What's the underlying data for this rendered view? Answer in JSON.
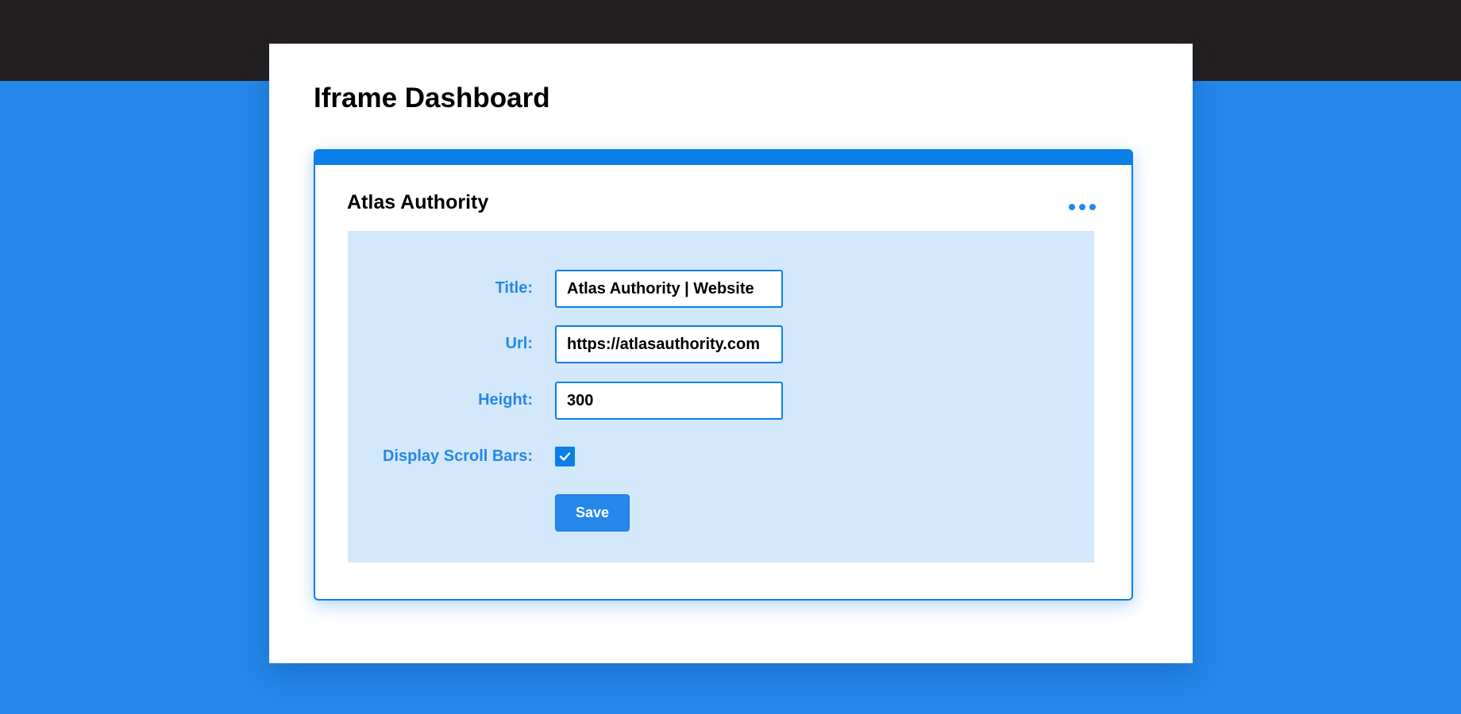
{
  "page": {
    "title": "Iframe Dashboard"
  },
  "widget": {
    "title": "Atlas Authority",
    "menu_icon": "more-horizontal-icon",
    "form": {
      "title_label": "Title:",
      "title_value": "Atlas Authority | Website",
      "url_label": "Url:",
      "url_value": "https://atlasauthority.com",
      "height_label": "Height:",
      "height_value": "300",
      "scrollbars_label": "Display Scroll Bars:",
      "scrollbars_checked": true,
      "save_label": "Save"
    }
  },
  "colors": {
    "background": "#2487e9",
    "topbar": "#231f20",
    "accent": "#0b7fe7",
    "form_background": "#d3e8fa",
    "label": "#2487e9"
  }
}
